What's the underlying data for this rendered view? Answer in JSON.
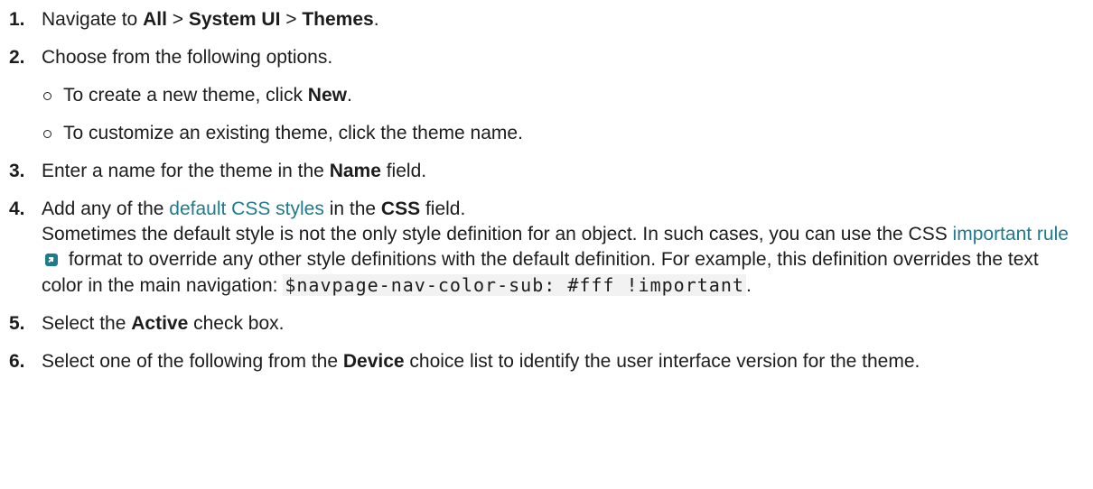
{
  "steps": [
    {
      "num": "1.",
      "pre": "Navigate to ",
      "b1": "All",
      "sep1": " > ",
      "b2": "System UI",
      "sep2": " > ",
      "b3": "Themes",
      "post": "."
    },
    {
      "num": "2.",
      "text": "Choose from the following options.",
      "sub": [
        {
          "pre": "To create a new theme, click ",
          "bold": "New",
          "post": "."
        },
        {
          "text": "To customize an existing theme, click the theme name."
        }
      ]
    },
    {
      "num": "3.",
      "pre": "Enter a name for the theme in the ",
      "bold": "Name",
      "post": " field."
    },
    {
      "num": "4.",
      "pre": "Add any of the ",
      "link": "default CSS styles",
      "mid": " in the ",
      "bold": "CSS",
      "post": " field.",
      "para_a": "Sometimes the default style is not the only style definition for an object. In such cases, you can use the CSS ",
      "link2": "important rule",
      "para_b": " format to override any other style definitions with the default definition. For example, this definition overrides the text color in the main navigation: ",
      "code": "$navpage-nav-color-sub: #fff !important",
      "para_end": "."
    },
    {
      "num": "5.",
      "pre": "Select the ",
      "bold": "Active",
      "post": " check box."
    },
    {
      "num": "6.",
      "pre": "Select one of the following from the ",
      "bold": "Device",
      "post": " choice list to identify the user interface version for the theme."
    }
  ],
  "colors": {
    "text": "#1c1c1c",
    "link": "#1f7a8c",
    "code_bg": "#f2f2f2"
  }
}
